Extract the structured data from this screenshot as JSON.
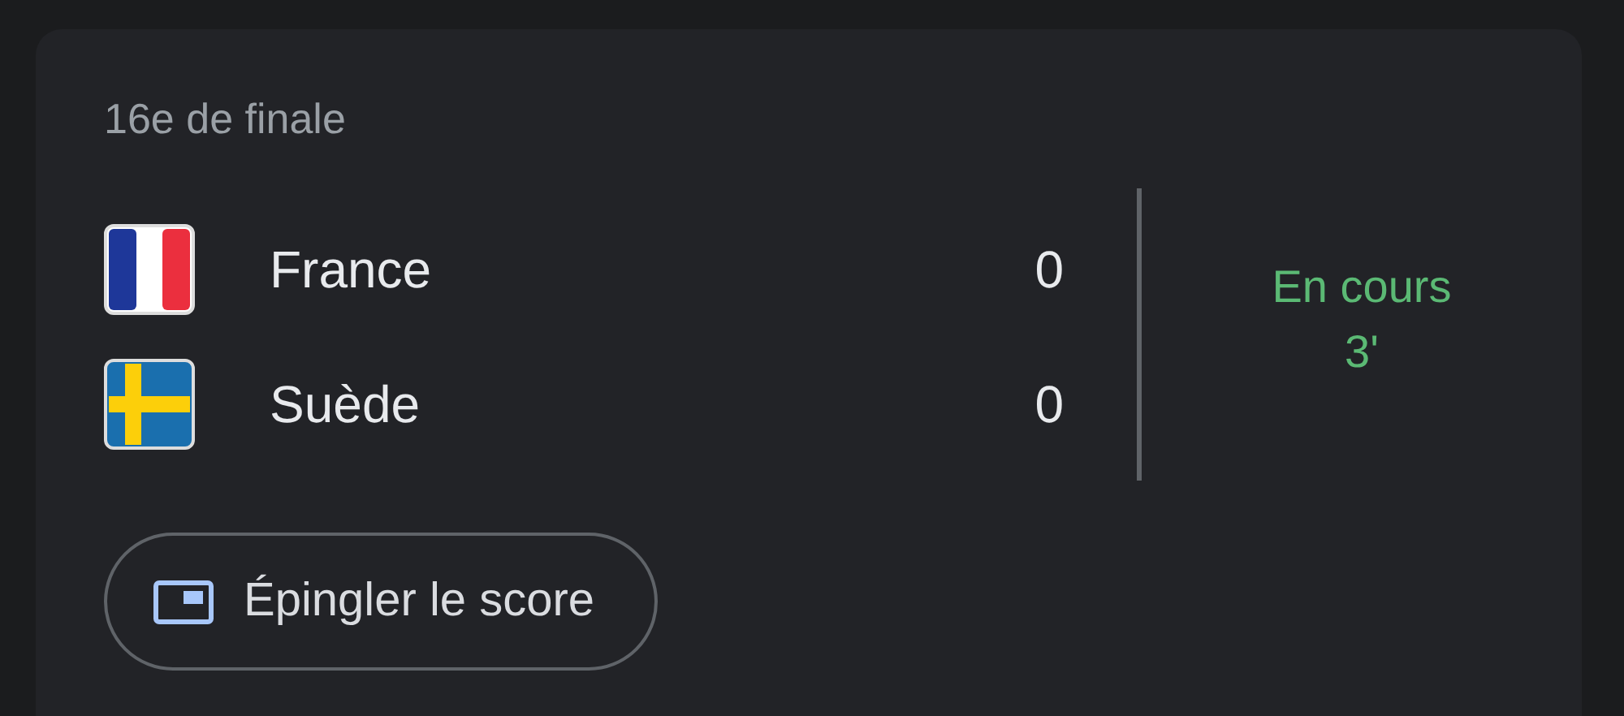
{
  "card": {
    "round": "16e de finale",
    "teams": [
      {
        "kind": "france",
        "name": "France",
        "score": "0"
      },
      {
        "kind": "sweden",
        "name": "Suède",
        "score": "0"
      }
    ],
    "status": {
      "label": "En cours",
      "minute": "3'"
    },
    "pin_button": {
      "label": "Épingler le score"
    }
  }
}
